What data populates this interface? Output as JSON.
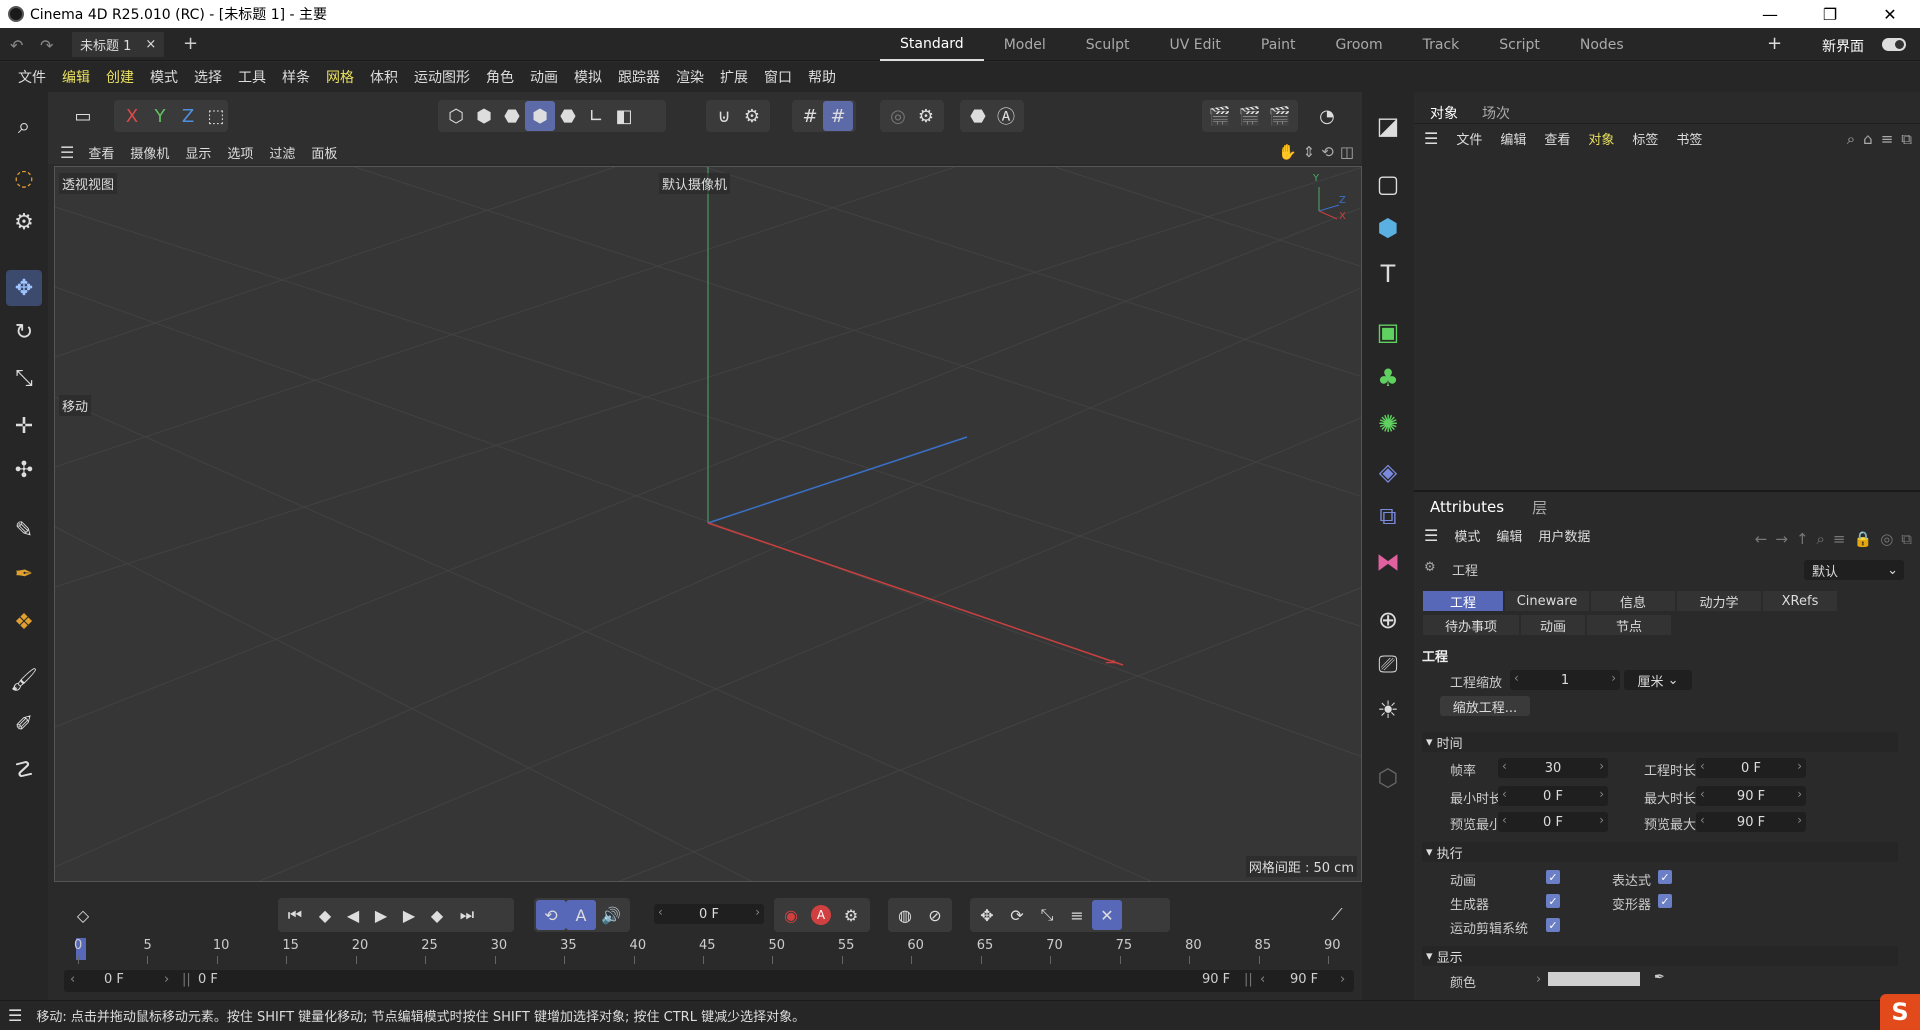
{
  "window": {
    "title": "Cinema 4D R25.010 (RC) - [未标题 1] - 主要",
    "controls": [
      "—",
      "❐",
      "✕"
    ]
  },
  "tabs": {
    "document": "未标题 1",
    "close": "×",
    "add": "+",
    "layouts": [
      "Standard",
      "Model",
      "Sculpt",
      "UV Edit",
      "Paint",
      "Groom",
      "Track",
      "Script",
      "Nodes"
    ],
    "active_layout": "Standard",
    "add_layout": "+",
    "new_ui_label": "新界面"
  },
  "menu": [
    "文件",
    "编辑",
    "创建",
    "模式",
    "选择",
    "工具",
    "样条",
    "网格",
    "体积",
    "运动图形",
    "角色",
    "动画",
    "模拟",
    "跟踪器",
    "渲染",
    "扩展",
    "窗口",
    "帮助"
  ],
  "axis_buttons": {
    "x": "X",
    "y": "Y",
    "z": "Z"
  },
  "viewport_menu": [
    "查看",
    "摄像机",
    "显示",
    "选项",
    "过滤",
    "面板"
  ],
  "viewport": {
    "view_name": "透视视图",
    "camera_name": "默认摄像机",
    "hud_move": "移动",
    "grid_spacing": "网格间距 : 50 cm",
    "axis_y": "Y",
    "axis_z": "Z",
    "axis_x": "X"
  },
  "object_manager": {
    "tabs": [
      "对象",
      "场次"
    ],
    "menu": [
      "文件",
      "编辑",
      "查看",
      "对象",
      "标签",
      "书签"
    ]
  },
  "attributes": {
    "tabs": [
      "Attributes",
      "层"
    ],
    "menu": [
      "模式",
      "编辑",
      "用户数据"
    ],
    "object_label": "工程",
    "preset": "默认",
    "subtabs_row1": [
      "工程",
      "Cineware",
      "信息",
      "动力学",
      "XRefs"
    ],
    "subtabs_row2": [
      "待办事项",
      "动画",
      "节点"
    ],
    "section_project": "工程",
    "project_scale_label": "工程缩放",
    "project_scale_value": "1",
    "project_scale_unit": "厘米",
    "scale_project_button": "缩放工程...",
    "section_time": "时间",
    "fps_label": "帧率",
    "fps_value": "30",
    "project_length_label": "工程时长",
    "project_length_value": "0 F",
    "min_time_label": "最小时长",
    "min_time_value": "0 F",
    "max_time_label": "最大时长",
    "max_time_value": "90 F",
    "preview_min_label": "预览最小",
    "preview_min_value": "0 F",
    "preview_max_label": "预览最大",
    "preview_max_value": "90 F",
    "section_exec": "执行",
    "exec_animation": "动画",
    "exec_expression": "表达式",
    "exec_generator": "生成器",
    "exec_deformer": "变形器",
    "exec_motion": "运动剪辑系统",
    "section_display": "显示",
    "color_label": "颜色"
  },
  "timeline": {
    "current_frame": "0 F",
    "ticks": [
      "0",
      "5",
      "10",
      "15",
      "20",
      "25",
      "30",
      "35",
      "40",
      "45",
      "50",
      "55",
      "60",
      "65",
      "70",
      "75",
      "80",
      "85",
      "90"
    ],
    "range_start": "0 F",
    "range_inner_start": "0 F",
    "range_inner_end": "90 F",
    "range_end": "90 F"
  },
  "status": {
    "text": "移动: 点击并拖动鼠标移动元素。按住 SHIFT 键量化移动; 节点编辑模式时按住 SHIFT 键增加选择对象; 按住 CTRL 键减少选择对象。"
  },
  "colors": {
    "accent": "#5868b8",
    "menu_highlight": "#e8e060",
    "axis_x": "#d04040",
    "axis_y": "#40b060",
    "axis_z": "#3070d0"
  }
}
